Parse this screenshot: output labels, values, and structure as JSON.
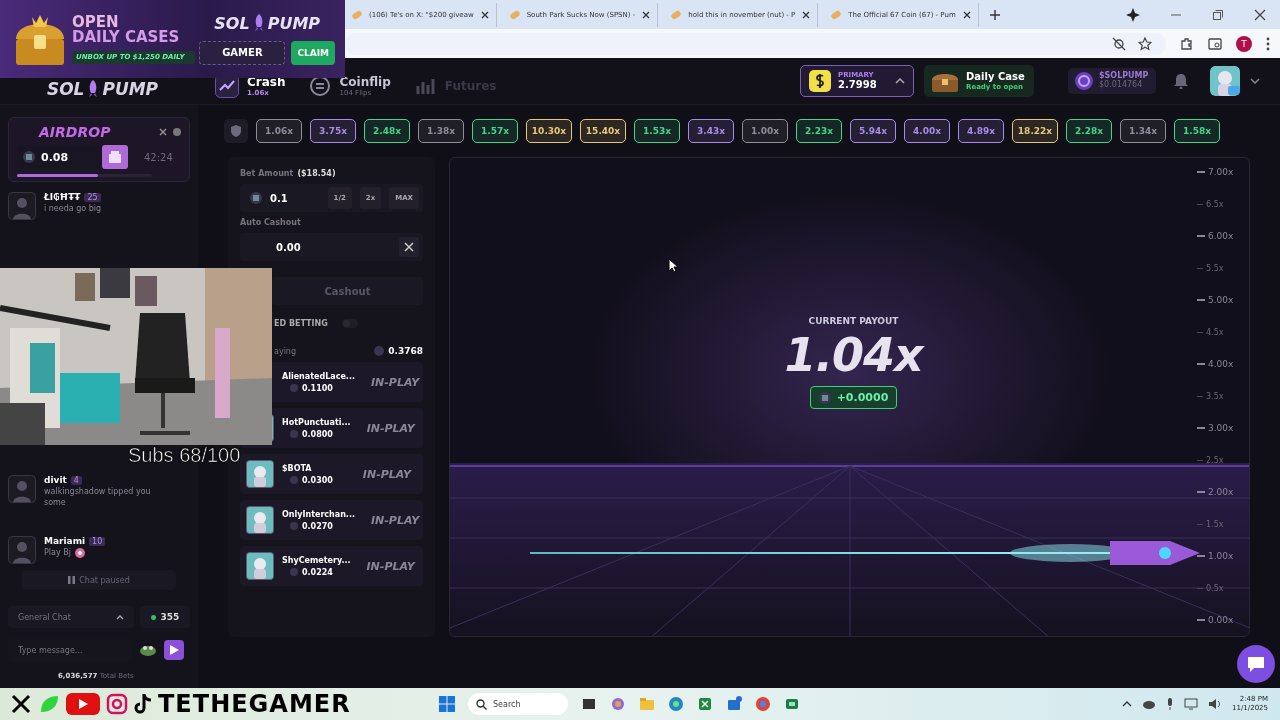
{
  "browser": {
    "tabs": [
      {
        "title": "(106) Te's on X: \"$200 giveaw",
        "selected": false
      },
      {
        "title": "South Park Sucks Now (SPSN) -",
        "selected": false
      },
      {
        "title": "hold this in november (nut) - P",
        "selected": false
      },
      {
        "title": "The Official 67 Coin (67) - Pum",
        "selected": false
      }
    ],
    "profile": "T"
  },
  "banner": {
    "line1": "OPEN",
    "line2": "DAILY CASES",
    "tagline": "UNBOX UP TO $1,250 DAILY",
    "logo": {
      "left": "SOL",
      "right": "PUMP"
    },
    "code": "GAMER",
    "claim": "CLAIM"
  },
  "header": {
    "logo": {
      "left": "SOL",
      "right": "PUMP"
    },
    "nav": [
      {
        "kind": "crash",
        "label": "Crash",
        "sub": "1.06x",
        "selected": true,
        "disabled": false
      },
      {
        "kind": "coinflip",
        "label": "Coinflip",
        "sub": "104 Flips",
        "selected": false,
        "disabled": false
      },
      {
        "kind": "futures",
        "label": "Futures",
        "selected": false,
        "disabled": true
      }
    ],
    "wallet": {
      "label": "PRIMARY",
      "amount": "2.7998"
    },
    "daily_case": {
      "title": "Daily Case",
      "status": "Ready to open"
    },
    "token": {
      "symbol": "$SOLPUMP",
      "price": "$0.014764"
    }
  },
  "multipliers": [
    {
      "value": "1.06x",
      "color": "#8f8c9c"
    },
    {
      "value": "3.75x",
      "color": "#a98be8"
    },
    {
      "value": "2.48x",
      "color": "#43d58a"
    },
    {
      "value": "1.38x",
      "color": "#8f8c9c"
    },
    {
      "value": "1.57x",
      "color": "#43d58a"
    },
    {
      "value": "10.30x",
      "color": "#e8c878"
    },
    {
      "value": "15.40x",
      "color": "#e8c878"
    },
    {
      "value": "1.53x",
      "color": "#43d58a"
    },
    {
      "value": "3.43x",
      "color": "#a98be8"
    },
    {
      "value": "1.00x",
      "color": "#8f8c9c"
    },
    {
      "value": "2.23x",
      "color": "#43d58a"
    },
    {
      "value": "5.94x",
      "color": "#a98be8"
    },
    {
      "value": "4.00x",
      "color": "#a98be8"
    },
    {
      "value": "4.89x",
      "color": "#a98be8"
    },
    {
      "value": "18.22x",
      "color": "#e8c878"
    },
    {
      "value": "2.28x",
      "color": "#43d58a"
    },
    {
      "value": "1.34x",
      "color": "#8f8c9c"
    },
    {
      "value": "1.58x",
      "color": "#43d58a"
    }
  ],
  "airdrop": {
    "title": "AIRDROP",
    "amount": "0.08",
    "timer": "42:24",
    "level": 0.6
  },
  "chat": {
    "messages": [
      {
        "user": "ŁI₲ĦŦŦ",
        "level": "25",
        "text": "i needa go big",
        "emoji": false
      },
      {
        "user": "divit",
        "level": "4",
        "text": "walkingshadow tipped you some",
        "emoji": false
      },
      {
        "user": "Mariami",
        "level": "10",
        "text": "Play Bj",
        "emoji": true
      }
    ],
    "paused": "Chat paused",
    "channel": "General Chat",
    "online": "355",
    "placeholder": "Type message...",
    "total_bets": "**6,036,577** Total Bets"
  },
  "bet": {
    "amount_label": "Bet Amount",
    "amount_usd": "($18.54)",
    "amount": "0.1",
    "quick": [
      "1/2",
      "2x",
      "MAX"
    ],
    "auto_label": "Auto Cashout",
    "auto_value": "0.00",
    "cashout": "Cashout",
    "advanced_label": "ED BETTING",
    "advanced_on": false,
    "playing_label": "aying",
    "playing_total": "0.3768",
    "players": [
      {
        "name": "AlienatedLace...",
        "amount": "0.1100",
        "status": "IN-PLAY",
        "avatar": false
      },
      {
        "name": "HotPunctuati...",
        "amount": "0.0800",
        "status": "IN-PLAY",
        "avatar": true
      },
      {
        "name": "$BOTA",
        "amount": "0.0300",
        "status": "IN-PLAY",
        "avatar": true
      },
      {
        "name": "OnlyInterchan...",
        "amount": "0.0270",
        "status": "IN-PLAY",
        "avatar": true
      },
      {
        "name": "ShyCemetery...",
        "amount": "0.0224",
        "status": "IN-PLAY",
        "avatar": true
      }
    ]
  },
  "game": {
    "payout_label": "CURRENT PAYOUT",
    "multiplier": "1.04x",
    "profit": "+0.0000",
    "axis": [
      {
        "label": "7.00x",
        "major": true
      },
      {
        "label": "6.5x",
        "major": false
      },
      {
        "label": "6.00x",
        "major": true
      },
      {
        "label": "5.5x",
        "major": false
      },
      {
        "label": "5.00x",
        "major": true
      },
      {
        "label": "4.5x",
        "major": false
      },
      {
        "label": "4.00x",
        "major": true
      },
      {
        "label": "3.5x",
        "major": false
      },
      {
        "label": "3.00x",
        "major": true
      },
      {
        "label": "2.5x",
        "major": false
      },
      {
        "label": "2.00x",
        "major": true
      },
      {
        "label": "1.5x",
        "major": false
      },
      {
        "label": "1.00x",
        "major": true
      },
      {
        "label": "0.5x",
        "major": false
      },
      {
        "label": "0.00x",
        "major": true
      }
    ]
  },
  "stream": {
    "subs": "Subs 68/100",
    "channel": "TETHEGAMER"
  },
  "taskbar": {
    "search": "Search",
    "time": "2:48 PM",
    "date": "11/1/2025"
  }
}
